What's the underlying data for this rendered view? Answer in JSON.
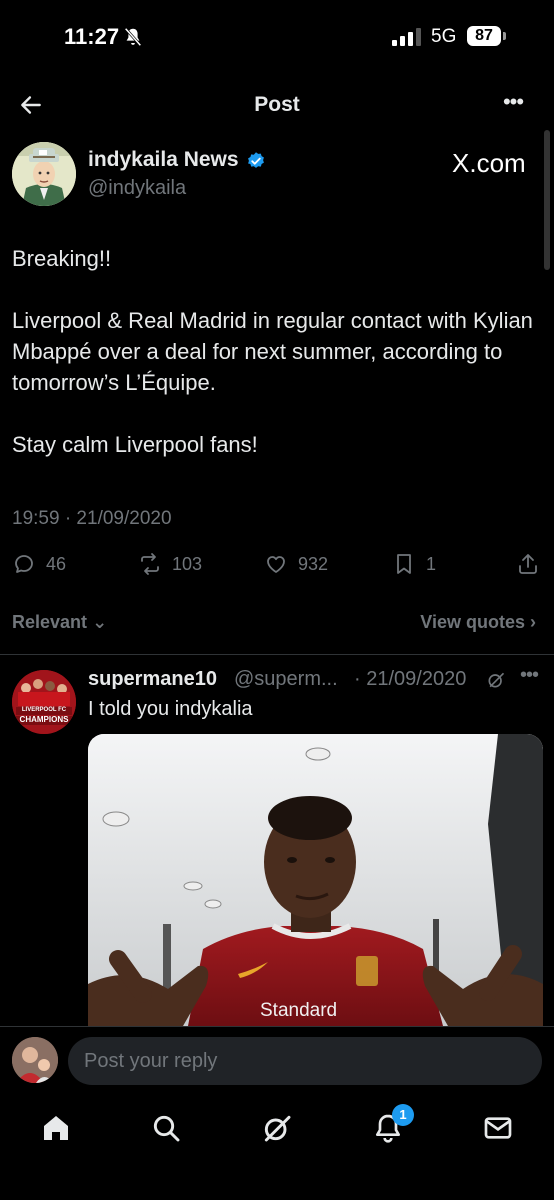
{
  "status_bar": {
    "time": "11:27",
    "network": "5G",
    "battery": "87"
  },
  "header": {
    "title": "Post"
  },
  "post": {
    "author_name": "indykaila News",
    "author_handle": "@indykaila",
    "source_brand": "X.com",
    "body": [
      "Breaking!!",
      "Liverpool & Real Madrid in regular contact with Kylian Mbappé over a deal for next summer, according to tomorrow’s L’Équipe.",
      "Stay calm Liverpool fans!"
    ],
    "timestamp": "19:59 · 21/09/2020",
    "replies": "46",
    "reposts": "103",
    "likes": "932",
    "bookmarks": "1"
  },
  "sort": {
    "label": "Relevant",
    "view_quotes": "View quotes"
  },
  "reply": {
    "user": "supermane10",
    "handle": "@superm...",
    "date": "· 21/09/2020",
    "text": "I told you indykalia",
    "avatar_text_1": "LIVERPOOL FC",
    "avatar_text_2": "CHAMPIONS",
    "image_caption": "Standard"
  },
  "composer": {
    "placeholder": "Post your reply"
  },
  "nav": {
    "notifications_badge": "1"
  },
  "colors": {
    "background": "#000000",
    "text": "#e7e9ea",
    "muted": "#71767b",
    "accent": "#1d9bf0"
  }
}
